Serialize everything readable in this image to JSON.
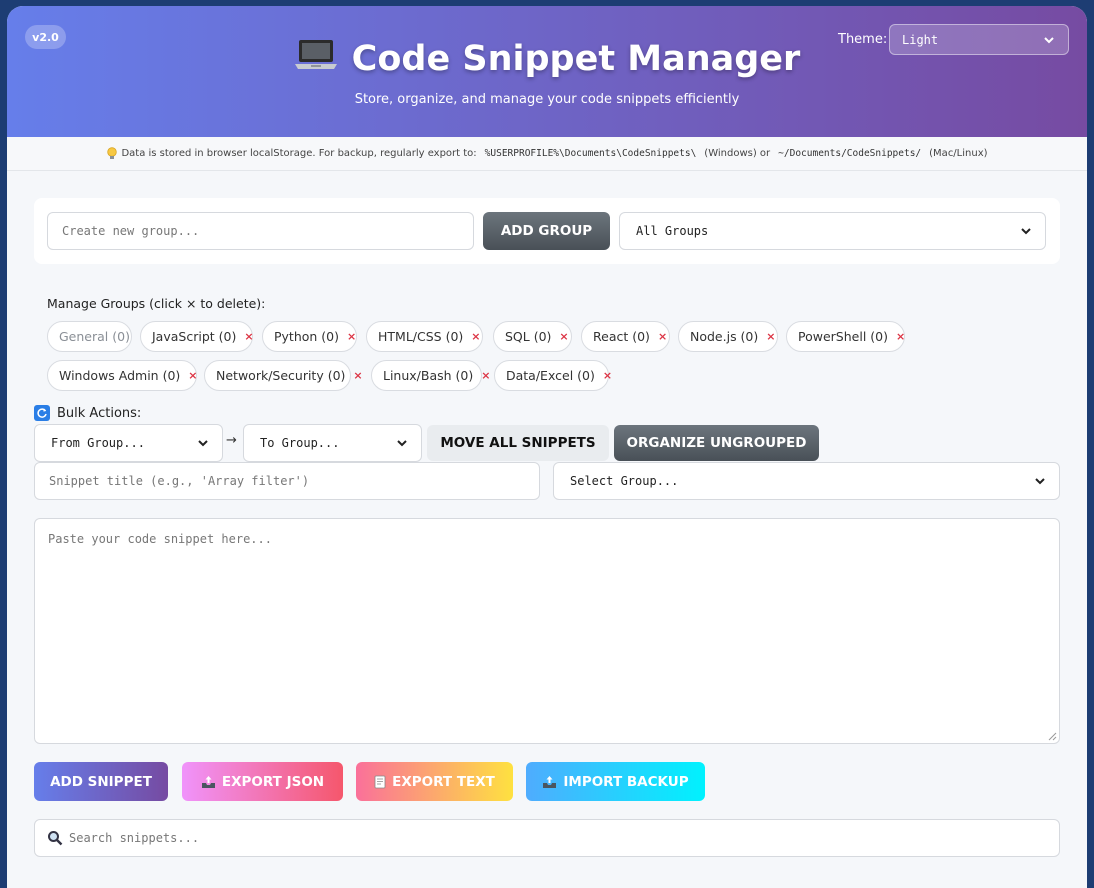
{
  "header": {
    "version": "v2.0",
    "title": "Code Snippet Manager",
    "subtitle": "Store, organize, and manage your code snippets efficiently",
    "theme_label": "Theme:",
    "theme_value": "Light"
  },
  "info": {
    "text_before": "Data is stored in browser localStorage. For backup, regularly export to:",
    "win_path": "%USERPROFILE%\\Documents\\CodeSnippets\\",
    "win_label": "(Windows) or",
    "mac_path": "~/Documents/CodeSnippets/",
    "mac_label": "(Mac/Linux)"
  },
  "groups_bar": {
    "new_group_placeholder": "Create new group...",
    "add_group_label": "ADD GROUP",
    "filter_value": "All Groups"
  },
  "manage": {
    "label": "Manage Groups (click × to delete):",
    "groups": [
      {
        "label": "General (0)",
        "deletable": false
      },
      {
        "label": "JavaScript (0)",
        "deletable": true
      },
      {
        "label": "Python (0)",
        "deletable": true
      },
      {
        "label": "HTML/CSS (0)",
        "deletable": true
      },
      {
        "label": "SQL (0)",
        "deletable": true
      },
      {
        "label": "React (0)",
        "deletable": true
      },
      {
        "label": "Node.js (0)",
        "deletable": true
      },
      {
        "label": "PowerShell (0)",
        "deletable": true
      },
      {
        "label": "Windows Admin (0)",
        "deletable": true
      },
      {
        "label": "Network/Security (0)",
        "deletable": true
      },
      {
        "label": "Linux/Bash (0)",
        "deletable": true
      },
      {
        "label": "Data/Excel (0)",
        "deletable": true
      }
    ],
    "delete_symbol": "×"
  },
  "bulk": {
    "label": "Bulk Actions:",
    "from_value": "From Group...",
    "arrow": "→",
    "to_value": "To Group...",
    "move_label": "MOVE ALL SNIPPETS",
    "organize_label": "ORGANIZE UNGROUPED"
  },
  "snippet": {
    "title_placeholder": "Snippet title (e.g., 'Array filter')",
    "group_value": "Select Group...",
    "code_placeholder": "Paste your code snippet here..."
  },
  "actions": {
    "add": "ADD SNIPPET",
    "export_json": "EXPORT JSON",
    "export_text": "EXPORT TEXT",
    "import": "IMPORT BACKUP"
  },
  "search": {
    "placeholder": "Search snippets..."
  },
  "colors": {
    "header_start": "#667eea",
    "header_end": "#764ba2",
    "delete_x": "#dc3545",
    "page_bg": "#1d3d73"
  }
}
